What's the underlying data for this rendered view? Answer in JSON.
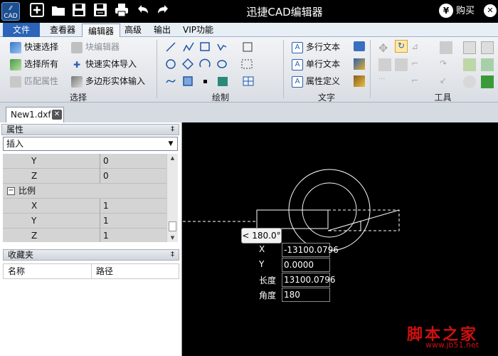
{
  "titlebar": {
    "logo_text": "CAD",
    "title": "迅捷CAD编辑器",
    "buy_label": "购买",
    "buy_symbol": "¥",
    "close_symbol": "✕"
  },
  "quick_access": [
    "new-icon",
    "open-folder-icon",
    "save-icon",
    "save-as-icon",
    "print-icon",
    "undo-icon",
    "redo-icon"
  ],
  "menu": {
    "file": "文件",
    "tabs": [
      "查看器",
      "编辑器",
      "高级",
      "输出",
      "VIP功能"
    ],
    "active": "编辑器"
  },
  "ribbon": {
    "select_group": {
      "label": "选择",
      "items": [
        "快速选择",
        "选择所有",
        "匹配属性",
        "块编辑器",
        "快速实体导入",
        "多边形实体输入"
      ]
    },
    "draw_group": {
      "label": "绘制"
    },
    "text_group": {
      "label": "文字",
      "items": [
        "多行文本",
        "单行文本",
        "属性定义"
      ]
    },
    "tools_group": {
      "label": "工具"
    }
  },
  "document_tab": {
    "name": "New1.dxf",
    "close_symbol": "✕"
  },
  "properties_panel": {
    "title": "属性",
    "pin": "‡",
    "combo_value": "插入",
    "rows": [
      {
        "name": "Y",
        "value": "0"
      },
      {
        "name": "Z",
        "value": "0"
      },
      {
        "name": "比例",
        "value": "",
        "category": true,
        "expander": "−"
      },
      {
        "name": "X",
        "value": "1"
      },
      {
        "name": "Y",
        "value": "1"
      },
      {
        "name": "Z",
        "value": "1"
      }
    ]
  },
  "favorites_panel": {
    "title": "收藏夹",
    "pin": "‡",
    "columns": [
      "名称",
      "路径"
    ]
  },
  "canvas": {
    "angle_tooltip": "< 180.0°",
    "dynamic_input": [
      {
        "label": "X",
        "value": "-13100.0796"
      },
      {
        "label": "Y",
        "value": "0.0000"
      },
      {
        "label": "长度",
        "value": "13100.0796"
      },
      {
        "label": "角度",
        "value": "180"
      }
    ],
    "watermark_text": "脚本之家",
    "watermark_url": "www.jb51.net"
  }
}
